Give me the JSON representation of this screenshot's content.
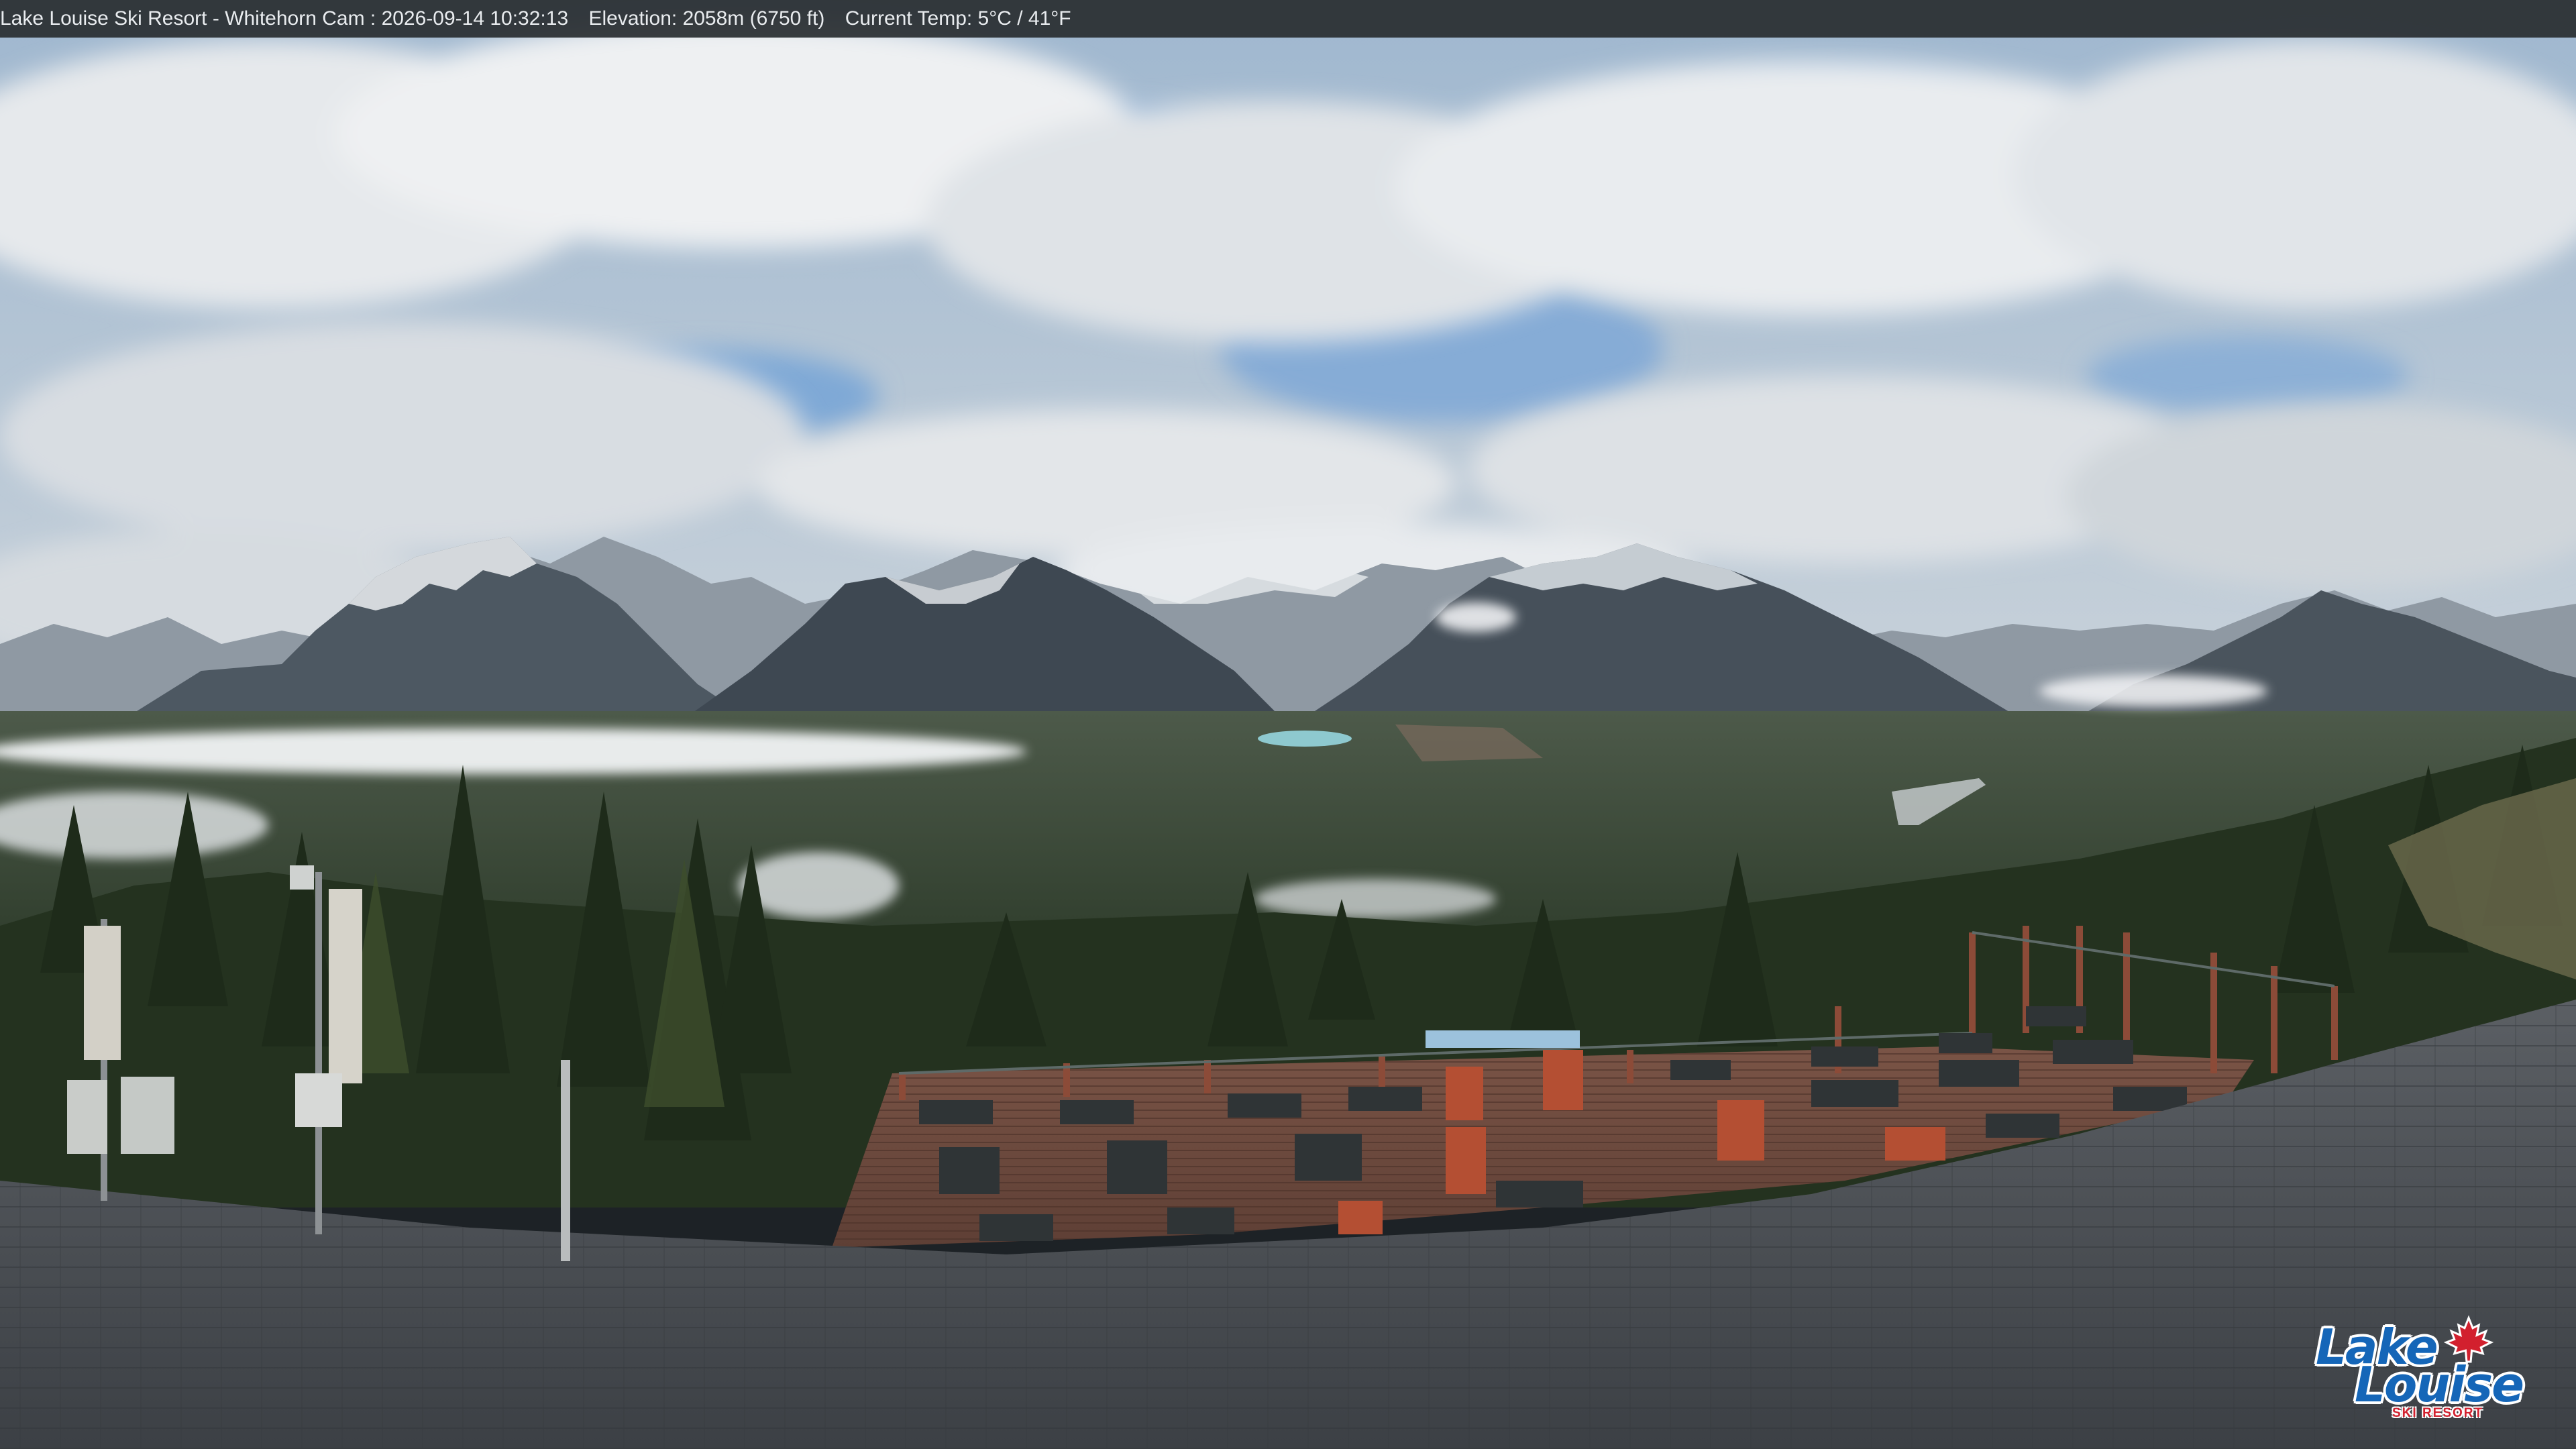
{
  "window": {
    "caption": {
      "resort": "Lake Louise Ski Resort - Whitehorn Cam : 2026-09-14 10:32:13",
      "elevation": "Elevation: 2058m (6750 ft)",
      "temperature": "Current Temp: 5°C / 41°F"
    }
  },
  "overlay": {
    "logo_line1": "Lake",
    "logo_line2": "Louise",
    "logo_line3": "SKI RESORT"
  },
  "colors": {
    "caption_bg": "#2b2f33",
    "logo_blue": "#1566b8",
    "logo_red": "#d2202e",
    "sky_blue": "#7fa9d6",
    "cloud": "#e6e9ec",
    "mountain_dark": "#3e4852",
    "forest": "#24321f",
    "deck_wood": "#6b4a3e",
    "roof": "#4d5156",
    "lake": "#8ec9cf"
  },
  "icons": {
    "logo_leaf": "maple-leaf-icon"
  }
}
